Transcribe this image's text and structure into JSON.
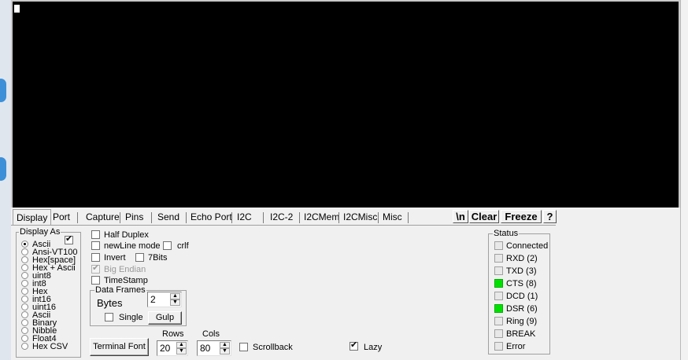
{
  "tabs": [
    {
      "label": "Display",
      "selected": true
    },
    {
      "label": "Port"
    },
    {
      "label": "Capture"
    },
    {
      "label": "Pins"
    },
    {
      "label": "Send"
    },
    {
      "label": "Echo Port"
    },
    {
      "label": "I2C"
    },
    {
      "label": "I2C-2"
    },
    {
      "label": "I2CMem"
    },
    {
      "label": "I2CMisc"
    },
    {
      "label": "Misc"
    }
  ],
  "toolbar": {
    "newline_label": "\\n",
    "clear_label": "Clear",
    "freeze_label": "Freeze",
    "help_label": "?"
  },
  "display_as": {
    "title": "Display As",
    "checkbox_checked": true,
    "options": [
      {
        "label": "Ascii",
        "selected": true
      },
      {
        "label": "Ansi-VT100"
      },
      {
        "label": "Hex[space]"
      },
      {
        "label": "Hex + Ascii"
      },
      {
        "label": "uint8"
      },
      {
        "label": "int8"
      },
      {
        "label": "Hex"
      },
      {
        "label": "int16"
      },
      {
        "label": "uint16"
      },
      {
        "label": "Ascii"
      },
      {
        "label": "Binary"
      },
      {
        "label": "Nibble"
      },
      {
        "label": "Float4"
      },
      {
        "label": "Hex CSV"
      }
    ]
  },
  "options": {
    "half_duplex": "Half Duplex",
    "newline_mode": "newLine mode",
    "crlf": "crlf",
    "invert": "Invert",
    "seven_bits": "7Bits",
    "big_endian": "Big Endian",
    "timestamp": "TimeStamp"
  },
  "data_frames": {
    "title": "Data Frames",
    "bytes_label": "Bytes",
    "bytes_value": "2",
    "single_label": "Single",
    "gulp_label": "Gulp"
  },
  "bottom": {
    "terminal_font_label": "Terminal Font",
    "rows_label": "Rows",
    "rows_value": "20",
    "cols_label": "Cols",
    "cols_value": "80",
    "scrollback_label": "Scrollback",
    "lazy_label": "Lazy",
    "lazy_checked": true
  },
  "status": {
    "title": "Status",
    "on_color": "#00e000",
    "items": [
      {
        "label": "Connected",
        "on": false
      },
      {
        "label": "RXD (2)",
        "on": false
      },
      {
        "label": "TXD (3)",
        "on": false
      },
      {
        "label": "CTS (8)",
        "on": true
      },
      {
        "label": "DCD (1)",
        "on": false
      },
      {
        "label": "DSR (6)",
        "on": true
      },
      {
        "label": "Ring (9)",
        "on": false
      },
      {
        "label": "BREAK",
        "on": false
      },
      {
        "label": "Error",
        "on": false
      }
    ]
  }
}
